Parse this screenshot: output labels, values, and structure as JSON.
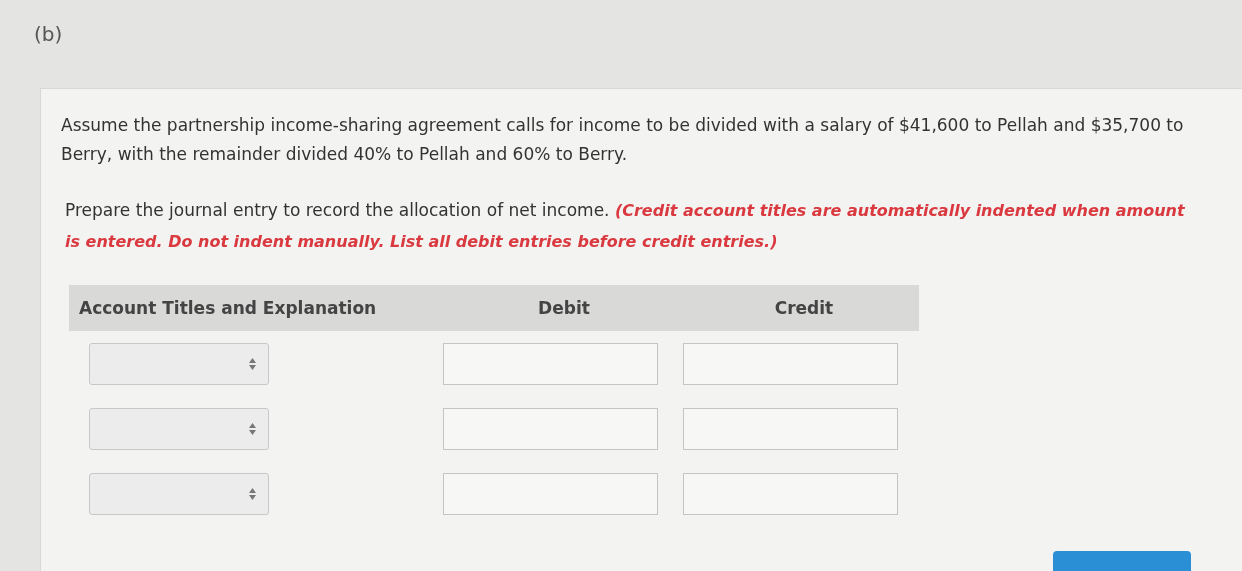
{
  "part_label": "(b)",
  "question": "Assume the partnership income-sharing agreement calls for income to be divided with a salary of $41,600 to Pellah and $35,700 to Berry, with the remainder divided 40% to Pellah and 60% to Berry.",
  "instruction": "Prepare the journal entry to record the allocation of net income. *(Credit account titles are automatically indented when amount is entered. Do not indent manually. List all debit entries before credit entries.)*",
  "table": {
    "columns": [
      "Account Titles and Explanation",
      "Debit",
      "Credit"
    ],
    "rows": [
      {
        "kind": "entry"
      },
      {
        "kind": "entry"
      },
      {
        "kind": "entry"
      }
    ]
  },
  "action_button": {
    "kind": "primary"
  }
}
